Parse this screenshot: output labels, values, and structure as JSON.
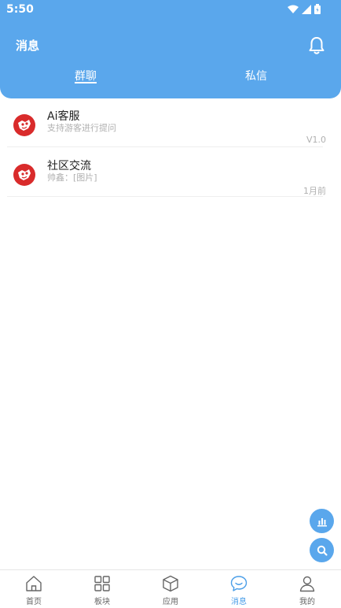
{
  "status": {
    "time": "5:50"
  },
  "header": {
    "title": "消息"
  },
  "tabs": [
    {
      "label": "群聊",
      "active": true
    },
    {
      "label": "私信",
      "active": false
    }
  ],
  "chats": [
    {
      "title": "Ai客服",
      "subtitle": "支持游客进行提问",
      "meta": "V1.0",
      "avatar": "red-mascot-avatar"
    },
    {
      "title": "社区交流",
      "subtitle": "帅鑫：[图片]",
      "meta": "1月前",
      "avatar": "red-mascot-avatar"
    }
  ],
  "fabs": [
    {
      "icon": "bar-chart-icon"
    },
    {
      "icon": "search-icon"
    }
  ],
  "nav": [
    {
      "label": "首页",
      "icon": "home-icon"
    },
    {
      "label": "板块",
      "icon": "grid-icon"
    },
    {
      "label": "应用",
      "icon": "cube-icon"
    },
    {
      "label": "消息",
      "icon": "chat-bubble-icon",
      "active": true
    },
    {
      "label": "我的",
      "icon": "user-icon"
    }
  ],
  "colors": {
    "primary": "#5aa7ec",
    "active_nav": "#4a9ee8",
    "muted_text": "#b0b0b0"
  }
}
